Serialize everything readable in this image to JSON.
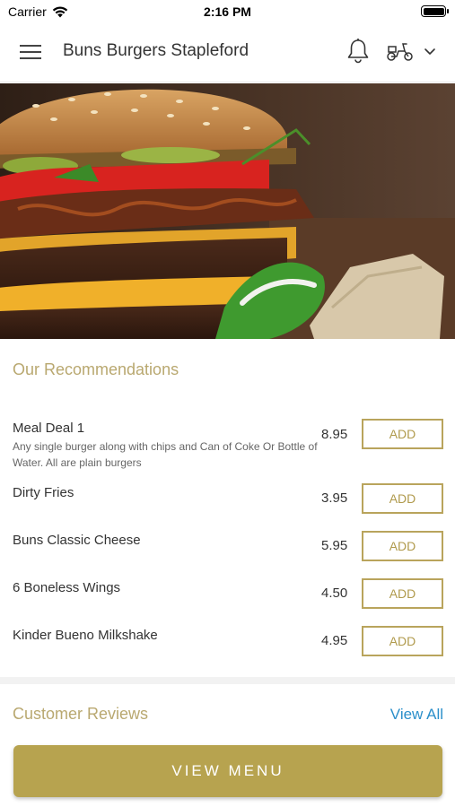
{
  "status_bar": {
    "carrier": "Carrier",
    "time": "2:16 PM"
  },
  "nav": {
    "title": "Buns Burgers Stapleford",
    "icons": [
      "menu-icon",
      "bell-icon",
      "scooter-icon",
      "chevron-down-icon"
    ]
  },
  "recommendations": {
    "title": "Our Recommendations",
    "add_label": "ADD",
    "items": [
      {
        "name": "Meal Deal 1",
        "description": "Any single burger along with chips and Can of Coke Or Bottle of Water. All are plain burgers",
        "price": "8.95"
      },
      {
        "name": "Dirty Fries",
        "price": "3.95"
      },
      {
        "name": "Buns Classic Cheese",
        "price": "5.95"
      },
      {
        "name": "6 Boneless Wings",
        "price": "4.50"
      },
      {
        "name": "Kinder Bueno Milkshake",
        "price": "4.95"
      }
    ]
  },
  "reviews": {
    "title": "Customer Reviews",
    "view_all": "View All"
  },
  "view_menu": "VIEW MENU",
  "colors": {
    "accent": "#b7a34f",
    "section_title": "#b9a870",
    "link": "#2b8fca"
  }
}
